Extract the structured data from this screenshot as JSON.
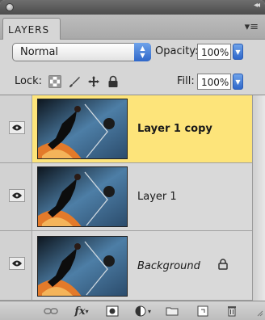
{
  "panel": {
    "tab_label": "LAYERS",
    "collapse_glyph": "◂◂",
    "menu_glyph": "▾≡"
  },
  "controls": {
    "blend_mode": "Normal",
    "opacity_label": "Opacity:",
    "opacity_value": "100%",
    "lock_label": "Lock:",
    "fill_label": "Fill:",
    "fill_value": "100%",
    "lock_icons": [
      "lock-transparent-pixels-icon",
      "lock-image-pixels-icon",
      "lock-position-icon",
      "lock-all-icon"
    ]
  },
  "layers": [
    {
      "name": "Layer 1 copy",
      "selected": true,
      "visible": true,
      "locked": false
    },
    {
      "name": "Layer 1",
      "selected": false,
      "visible": true,
      "locked": false
    },
    {
      "name": "Background",
      "selected": false,
      "visible": true,
      "locked": true
    }
  ],
  "bottom_bar": {
    "fx_label": "fx",
    "icons": [
      "link-layers-icon",
      "layer-style-icon",
      "add-mask-icon",
      "adjustment-layer-icon",
      "new-group-icon",
      "new-layer-icon",
      "trash-icon"
    ]
  },
  "colors": {
    "selected_row": "#fde47a",
    "accent_blue": "#2f67c9"
  }
}
